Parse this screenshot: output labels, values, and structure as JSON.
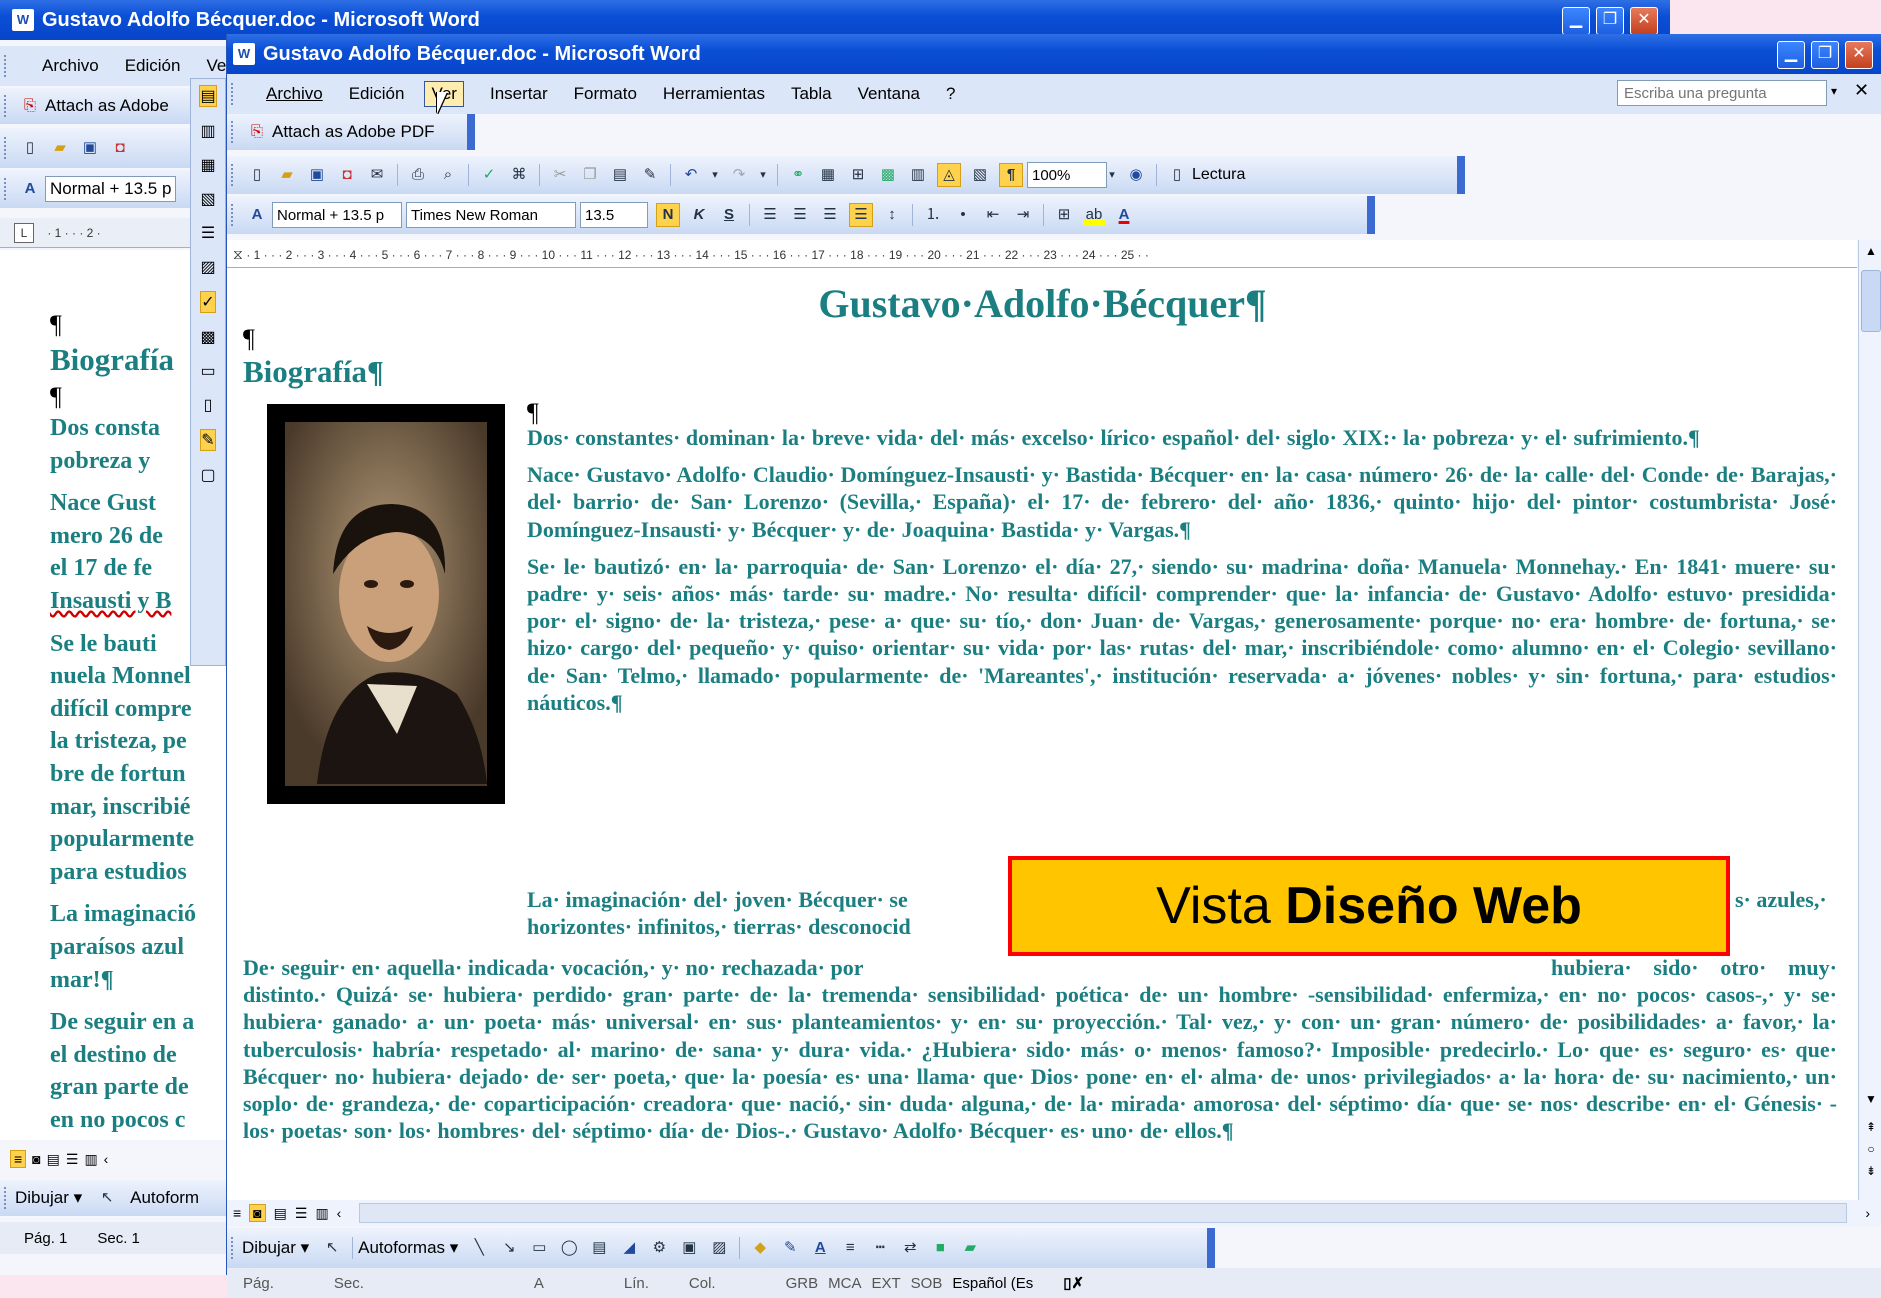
{
  "back_window": {
    "title": "Gustavo Adolfo Bécquer.doc - Microsoft Word",
    "menu": [
      "Archivo",
      "Edición",
      "Ver"
    ],
    "attach_label": "Attach as Adobe",
    "style_combo": "Normal + 13.5 p",
    "ruler_marks": "· 1 · · · 2 ·",
    "doc": {
      "pilcrow": "¶",
      "heading": "Biografía",
      "lines": [
        "Dos consta",
        "pobreza y",
        "Nace Gust",
        "mero 26 de",
        "el 17 de fe",
        "Insausti y B",
        "Se le bauti",
        "nuela Monnel",
        "difícil compre",
        "la tristeza, pe",
        "bre de fortun",
        "mar, inscribié",
        "popularmente",
        "para estudios",
        "La imaginació",
        "paraísos azul",
        "mar!¶",
        "De seguir en a",
        "el destino de",
        "gran parte de",
        "en no pocos c"
      ]
    },
    "draw_label": "Dibujar ▾",
    "autoforms_label": "Autoform",
    "status": {
      "page": "Pág. 1",
      "sec": "Sec. 1"
    }
  },
  "front_window": {
    "title": "Gustavo Adolfo Bécquer.doc - Microsoft Word",
    "menu": [
      {
        "label": "Archivo"
      },
      {
        "label": "Edición"
      },
      {
        "label": "Ver"
      },
      {
        "label": "Insertar"
      },
      {
        "label": "Formato"
      },
      {
        "label": "Herramientas"
      },
      {
        "label": "Tabla"
      },
      {
        "label": "Ventana"
      },
      {
        "label": "?"
      }
    ],
    "question_placeholder": "Escriba una pregunta",
    "attach_label": "Attach as Adobe PDF",
    "zoom": "100%",
    "reading_label": "Lectura",
    "style_combo": "Normal + 13.5 p",
    "font_combo": "Times New Roman",
    "size_combo": "13.5",
    "bold_label": "N",
    "italic_label": "K",
    "underline_label": "S",
    "ruler_numbers": "· 1 · · · 2 · · · 3 · · · 4 · · · 5 · · · 6 · · · 7 · · · 8 · · · 9 · · · 10 · · · 11 · · · 12 · · · 13 · · · 14 · · · 15 · · · 16 · · · 17 · · · 18 · · · 19 · · · 20 · · · 21 · · · 22 · · · 23 · · · 24 · · · 25 · ·",
    "draw_label": "Dibujar ▾",
    "autoforms_label": "Autoformas ▾",
    "status": {
      "page": "Pág.",
      "sec": "Sec.",
      "a": "A",
      "lin": "Lín.",
      "col": "Col.",
      "grb": "GRB",
      "mca": "MCA",
      "ext": "EXT",
      "sob": "SOB",
      "lang": "Español (Es"
    }
  },
  "document": {
    "title": "Gustavo·Adolfo·Bécquer¶",
    "pilcrow": "¶",
    "section": "Biografía¶",
    "paragraphs": [
      "Dos· constantes· dominan· la· breve· vida· del· más· excelso· lírico· español· del· siglo· XIX:· la· pobreza· y· el· sufrimiento.¶",
      "Nace· Gustavo· Adolfo· Claudio· Domínguez-Insausti· y· Bastida· Bécquer· en· la· casa· número· 26· de· la· calle· del· Conde· de· Barajas,· del· barrio· de· San· Lorenzo· (Sevilla,· España)· el· 17· de· febrero· del· año· 1836,· quinto· hijo· del· pintor· costumbrista· José· Domínguez-Insausti· y· Bécquer· y· de· Joaquina· Bastida· y· Vargas.¶",
      "Se· le· bautizó· en· la· parroquia· de· San· Lorenzo· el· día· 27,· siendo· su· madrina· doña· Manuela· Monnehay.· En· 1841· muere· su· padre· y· seis· años· más· tarde· su· madre.· No· resulta· difícil· comprender· que· la· infancia· de· Gustavo· Adolfo· estuvo· presidida· por· el· signo· de· la· tristeza,· pese· a· que· su· tío,· don· Juan· de· Vargas,· generosamente· porque· no· era· hombre· de· fortuna,· se· hizo· cargo· del· pequeño· y· quiso· orientar· su· vida· por· las· rutas· del· mar,· inscribiéndole· como· alumno· en· el· Colegio· sevillano· de· San· Telmo,· llamado· popularmente· de· 'Mareantes',· institución· reservada· a· jóvenes· nobles· y· sin· fortuna,· para· estudios· náuticos.¶",
      "La· imaginación· del· joven· Bécquer· se",
      "s· azules,·",
      "horizontes· infinitos,· tierras· desconocid",
      "De· seguir· en· aquella· indicada· vocación,· y· no· rechazada· por",
      "hubiera· sido· otro· muy· distinto.· Quizá· se· hubiera· perdido· gran· parte· de· la· tremenda· sensibilidad· poética· de· un· hombre· -sensibilidad· enfermiza,· en· no· pocos· casos-,· y· se· hubiera· ganado· a· un· poeta· más· universal· en· sus· planteamientos· y· en· su· proyección.· Tal· vez,· y· con· un· gran· número· de· posibilidades· a· favor,· la· tuberculosis· habría· respetado· al· marino· de· sana· y· dura· vida.· ¿Hubiera· sido· más· o· menos· famoso?· Imposible· predecirlo.· Lo· que· es· seguro· es· que· Bécquer· no· hubiera· dejado· de· ser· poeta,· que· la· poesía· es· una· llama· que· Dios· pone· en· el· alma· de· unos· privilegiados· a· la· hora· de· su· nacimiento,· un· soplo· de· grandeza,· de· coparticipación· creadora· que· nació,· sin· duda· alguna,· de· la· mirada· amorosa· del· séptimo· día· que· se· nos· describe· en· el· Génesis· -los· poetas· son· los· hombres· del· séptimo· día· de· Dios-.· Gustavo· Adolfo· Bécquer· es· uno· de· ellos.¶"
    ]
  },
  "callout": {
    "prefix": "Vista ",
    "bold": "Diseño Web",
    "bg": "#ffc600",
    "border": "#ff0000"
  }
}
